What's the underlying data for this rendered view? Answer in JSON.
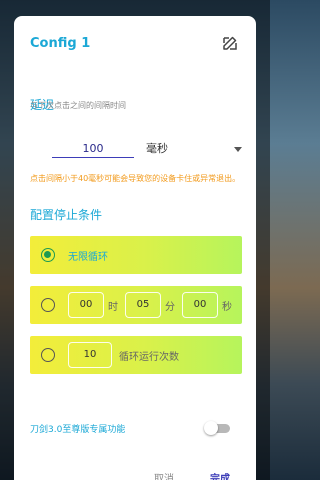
{
  "dialog": {
    "title": "Config 1",
    "edit_icon": "edit-icon"
  },
  "delay": {
    "heading": "延迟",
    "subtitle": "与下次点击之间的间隔时间",
    "value": "100",
    "unit": "毫秒",
    "warning": "点击间隔小于40毫秒可能会导致您的设备卡住或异常退出。"
  },
  "stop_condition": {
    "heading": "配置停止条件",
    "infinite_label": "无限循环",
    "time": {
      "hours": "00",
      "hours_unit": "时",
      "minutes": "05",
      "minutes_unit": "分",
      "seconds": "00",
      "seconds_unit": "秒"
    },
    "count": {
      "value": "10",
      "label": "循环运行次数"
    },
    "selected": "infinite"
  },
  "premium": {
    "label": "刀剑3.0至尊版专属功能",
    "enabled": false
  },
  "buttons": {
    "cancel": "取消",
    "done": "完成"
  },
  "colors": {
    "accent": "#1ba8d6",
    "warning": "#f29a1b",
    "primary": "#3d3db8",
    "radio_selected": "#1e9a52",
    "option_gradient": [
      "#f3ed3a",
      "#b6f45c"
    ]
  }
}
